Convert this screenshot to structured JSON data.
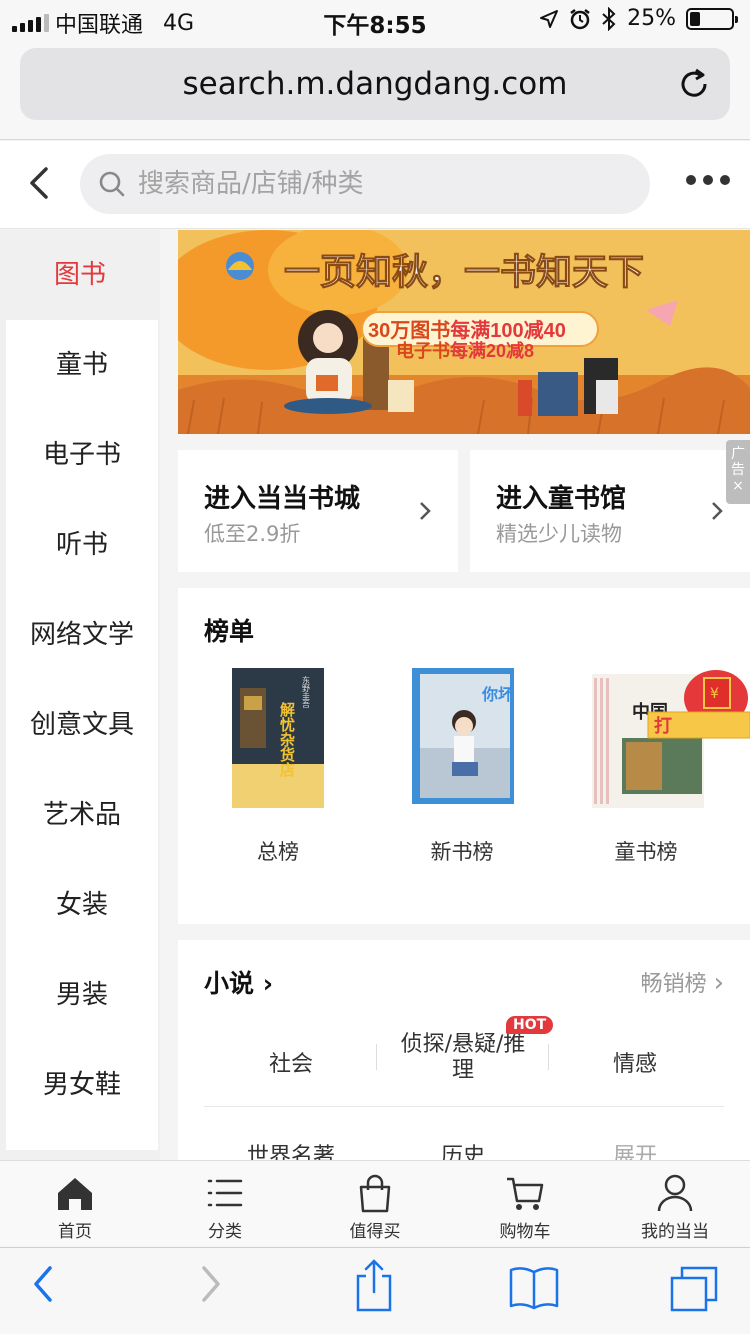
{
  "status_bar": {
    "carrier": "中国联通",
    "network": "4G",
    "time": "下午8:55",
    "battery": "25%",
    "battery_level": 0.25
  },
  "browser": {
    "url": "search.m.dangdang.com"
  },
  "header": {
    "search_placeholder": "搜索商品/店铺/种类"
  },
  "sidebar": {
    "items": [
      {
        "label": "图书",
        "active": true
      },
      {
        "label": "童书"
      },
      {
        "label": "电子书"
      },
      {
        "label": "听书"
      },
      {
        "label": "网络文学"
      },
      {
        "label": "创意文具"
      },
      {
        "label": "艺术品"
      },
      {
        "label": "女装"
      },
      {
        "label": "男装"
      },
      {
        "label": "男女鞋"
      }
    ]
  },
  "banner": {
    "headline": "一页知秋，一书知天下",
    "line1_prefix": "30万图书",
    "line1_suffix": "每满100减40",
    "line2_prefix": "电子书",
    "line2_suffix": "每满20减8"
  },
  "quick_links": [
    {
      "title": "进入当当书城",
      "subtitle": "低至2.9折"
    },
    {
      "title": "进入童书馆",
      "subtitle": "精选少儿读物"
    }
  ],
  "ad_label": "广告",
  "ad_close": "×",
  "rankings": {
    "title": "榜单",
    "items": [
      {
        "label": "总榜",
        "cover_text": "解忧杂货店",
        "author": "东野圭吾"
      },
      {
        "label": "新书榜",
        "cover_text": "你坏"
      },
      {
        "label": "童书榜",
        "cover_text": "中国"
      }
    ],
    "promo_badge": "打",
    "promo_currency": "¥"
  },
  "novel": {
    "title": "小说",
    "more": "畅销榜",
    "tags": [
      "社会",
      "侦探/悬疑/推理",
      "情感",
      "世界名著",
      "历史",
      "展开"
    ],
    "hot_badge": "HOT"
  },
  "tabbar": {
    "items": [
      "首页",
      "分类",
      "值得买",
      "购物车",
      "我的当当"
    ]
  },
  "colors": {
    "accent_red": "#e3393c",
    "banner_orange": "#f0b64a",
    "ios_blue": "#1a73e8"
  }
}
